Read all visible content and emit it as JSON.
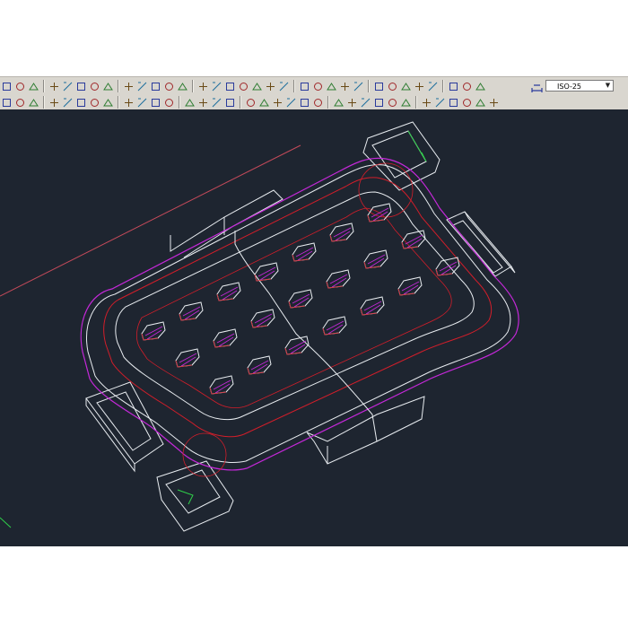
{
  "ribbon": {
    "dimension_style_value": "ISO-25",
    "dimension_style_dropdown_icon": "chevron-down-icon"
  },
  "toolbar_row1_icons": [
    "orbit-icon",
    "pan-icon",
    "zoom-realtime-icon",
    "zoom-previous-icon",
    "zoom-window-icon",
    "zoom-dynamic-icon",
    "zoom-scale-icon",
    "zoom-center-icon",
    "zoom-object-icon",
    "zoom-in-icon",
    "zoom-out-icon",
    "zoom-all-icon",
    "zoom-extents-icon",
    "linear-dim-icon",
    "aligned-dim-icon",
    "arc-length-icon",
    "ordinate-dim-icon",
    "radius-dim-icon",
    "jogged-dim-icon",
    "diameter-dim-icon",
    "angular-dim-icon",
    "quick-dim-icon",
    "baseline-dim-icon",
    "continue-dim-icon",
    "space-dim-icon",
    "break-dim-icon",
    "tolerance-icon",
    "center-mark-icon",
    "inspect-icon",
    "jogged-linear-icon",
    "dim-edit-icon",
    "dim-text-edit-icon",
    "dim-update-icon"
  ],
  "toolbar_row2_icons": [
    "named-views-icon",
    "top-view-icon",
    "bottom-view-icon",
    "left-view-icon",
    "right-view-icon",
    "front-view-icon",
    "back-view-icon",
    "iso-view-icon",
    "layer-icon",
    "layer-state-icon",
    "make-current-icon",
    "layer-previous-icon",
    "properties-icon",
    "match-properties-icon",
    "block-icon",
    "insert-icon",
    "group-icon",
    "ucs-icon",
    "ucs-world-icon",
    "ucs-previous-icon",
    "ucs-face-icon",
    "ucs-object-icon",
    "ucs-view-icon",
    "ucs-origin-icon",
    "visual-style-2d-icon",
    "wireframe-icon",
    "hidden-icon",
    "realistic-icon",
    "conceptual-icon",
    "render-icon",
    "light-icon",
    "material-icon",
    "camera-icon",
    "walk-icon"
  ],
  "colors": {
    "toolbar_bg": "#d9d6cf",
    "model_space_bg": "#1e2530",
    "geometry_white": "#e8ecf0",
    "geometry_red": "#d21e2a",
    "geometry_magenta": "#c428d8",
    "geometry_green": "#2fd24a",
    "geometry_cyan": "#4fd6e8"
  },
  "model": {
    "description_of_drawing": "",
    "grid_cells": 21
  }
}
